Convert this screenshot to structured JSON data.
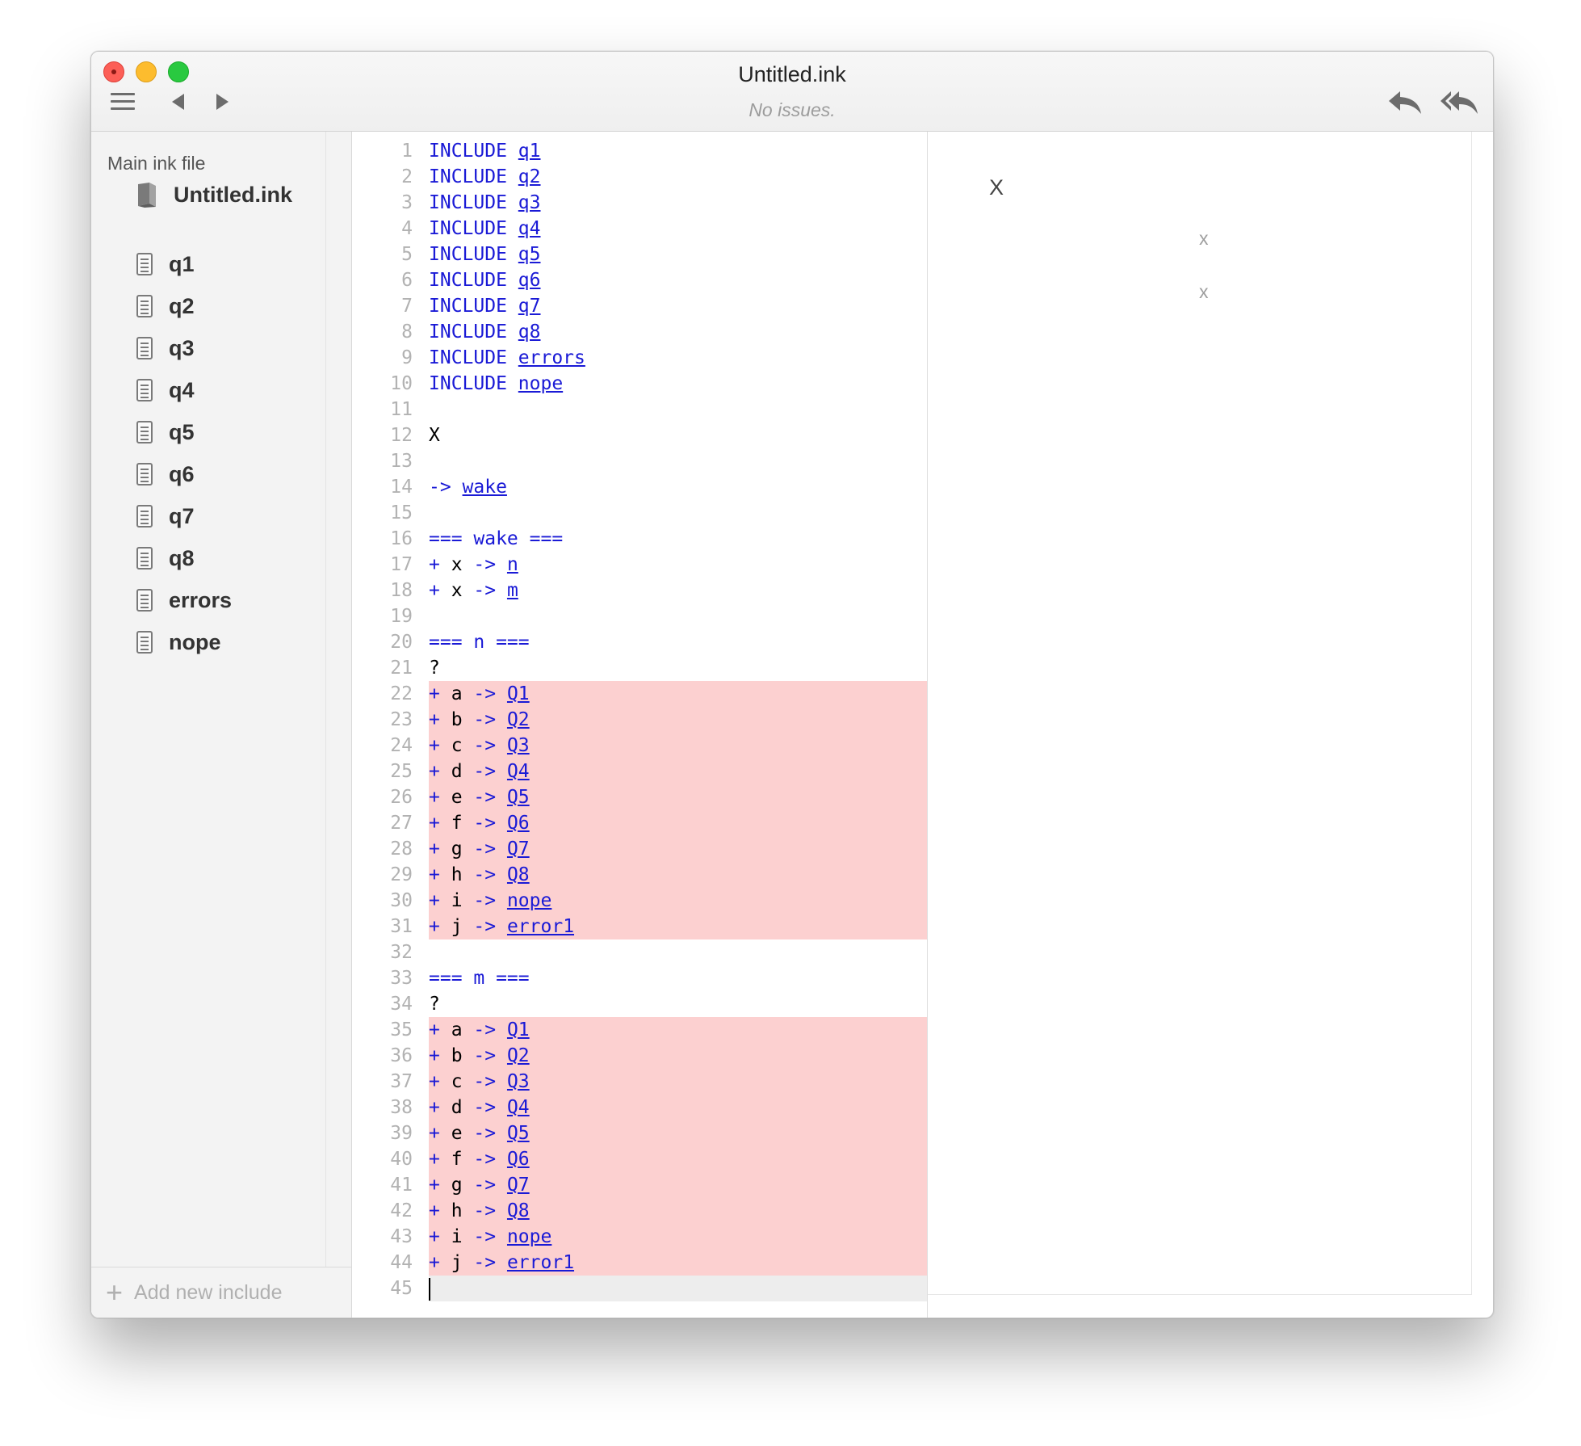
{
  "window": {
    "title": "Untitled.ink",
    "status": "No issues."
  },
  "toolbar": {
    "menu_icon": "hamburger-icon",
    "back_icon": "back-arrow-icon",
    "forward_icon": "forward-arrow-icon",
    "rewind_icon": "reply-icon",
    "restart_icon": "reply-all-icon"
  },
  "sidebar": {
    "heading": "Main ink file",
    "main_file": "Untitled.ink",
    "includes": [
      "q1",
      "q2",
      "q3",
      "q4",
      "q5",
      "q6",
      "q7",
      "q8",
      "errors",
      "nope"
    ],
    "add_label": "Add new include"
  },
  "editor": {
    "lines": [
      {
        "n": "1",
        "tokens": [
          [
            "kw",
            "INCLUDE "
          ],
          [
            "lnk",
            "q1"
          ]
        ]
      },
      {
        "n": "2",
        "tokens": [
          [
            "kw",
            "INCLUDE "
          ],
          [
            "lnk",
            "q2"
          ]
        ]
      },
      {
        "n": "3",
        "tokens": [
          [
            "kw",
            "INCLUDE "
          ],
          [
            "lnk",
            "q3"
          ]
        ]
      },
      {
        "n": "4",
        "tokens": [
          [
            "kw",
            "INCLUDE "
          ],
          [
            "lnk",
            "q4"
          ]
        ]
      },
      {
        "n": "5",
        "tokens": [
          [
            "kw",
            "INCLUDE "
          ],
          [
            "lnk",
            "q5"
          ]
        ]
      },
      {
        "n": "6",
        "tokens": [
          [
            "kw",
            "INCLUDE "
          ],
          [
            "lnk",
            "q6"
          ]
        ]
      },
      {
        "n": "7",
        "tokens": [
          [
            "kw",
            "INCLUDE "
          ],
          [
            "lnk",
            "q7"
          ]
        ]
      },
      {
        "n": "8",
        "tokens": [
          [
            "kw",
            "INCLUDE "
          ],
          [
            "lnk",
            "q8"
          ]
        ]
      },
      {
        "n": "9",
        "tokens": [
          [
            "kw",
            "INCLUDE "
          ],
          [
            "lnk",
            "errors"
          ]
        ]
      },
      {
        "n": "10",
        "tokens": [
          [
            "kw",
            "INCLUDE "
          ],
          [
            "lnk",
            "nope"
          ]
        ]
      },
      {
        "n": "11",
        "tokens": []
      },
      {
        "n": "12",
        "tokens": [
          [
            "txt",
            "X"
          ]
        ]
      },
      {
        "n": "13",
        "tokens": []
      },
      {
        "n": "14",
        "tokens": [
          [
            "kw",
            "-> "
          ],
          [
            "lnk",
            "wake"
          ]
        ]
      },
      {
        "n": "15",
        "tokens": []
      },
      {
        "n": "16",
        "tokens": [
          [
            "kw",
            "=== wake ==="
          ]
        ]
      },
      {
        "n": "17",
        "tokens": [
          [
            "kw",
            "+ "
          ],
          [
            "txt",
            "x "
          ],
          [
            "kw",
            "-> "
          ],
          [
            "lnk",
            "n"
          ]
        ]
      },
      {
        "n": "18",
        "tokens": [
          [
            "kw",
            "+ "
          ],
          [
            "txt",
            "x "
          ],
          [
            "kw",
            "-> "
          ],
          [
            "lnk",
            "m"
          ]
        ]
      },
      {
        "n": "19",
        "tokens": []
      },
      {
        "n": "20",
        "tokens": [
          [
            "kw",
            "=== n ==="
          ]
        ]
      },
      {
        "n": "21",
        "tokens": [
          [
            "txt",
            "?"
          ]
        ]
      },
      {
        "n": "22",
        "err": true,
        "tokens": [
          [
            "kw",
            "+ "
          ],
          [
            "txt",
            "a "
          ],
          [
            "kw",
            "-> "
          ],
          [
            "lnk",
            "Q1"
          ]
        ]
      },
      {
        "n": "23",
        "err": true,
        "tokens": [
          [
            "kw",
            "+ "
          ],
          [
            "txt",
            "b "
          ],
          [
            "kw",
            "-> "
          ],
          [
            "lnk",
            "Q2"
          ]
        ]
      },
      {
        "n": "24",
        "err": true,
        "tokens": [
          [
            "kw",
            "+ "
          ],
          [
            "txt",
            "c "
          ],
          [
            "kw",
            "-> "
          ],
          [
            "lnk",
            "Q3"
          ]
        ]
      },
      {
        "n": "25",
        "err": true,
        "tokens": [
          [
            "kw",
            "+ "
          ],
          [
            "txt",
            "d "
          ],
          [
            "kw",
            "-> "
          ],
          [
            "lnk",
            "Q4"
          ]
        ]
      },
      {
        "n": "26",
        "err": true,
        "tokens": [
          [
            "kw",
            "+ "
          ],
          [
            "txt",
            "e "
          ],
          [
            "kw",
            "-> "
          ],
          [
            "lnk",
            "Q5"
          ]
        ]
      },
      {
        "n": "27",
        "err": true,
        "tokens": [
          [
            "kw",
            "+ "
          ],
          [
            "txt",
            "f "
          ],
          [
            "kw",
            "-> "
          ],
          [
            "lnk",
            "Q6"
          ]
        ]
      },
      {
        "n": "28",
        "err": true,
        "tokens": [
          [
            "kw",
            "+ "
          ],
          [
            "txt",
            "g "
          ],
          [
            "kw",
            "-> "
          ],
          [
            "lnk",
            "Q7"
          ]
        ]
      },
      {
        "n": "29",
        "err": true,
        "tokens": [
          [
            "kw",
            "+ "
          ],
          [
            "txt",
            "h "
          ],
          [
            "kw",
            "-> "
          ],
          [
            "lnk",
            "Q8"
          ]
        ]
      },
      {
        "n": "30",
        "err": true,
        "tokens": [
          [
            "kw",
            "+ "
          ],
          [
            "txt",
            "i "
          ],
          [
            "kw",
            "-> "
          ],
          [
            "lnk",
            "nope"
          ]
        ]
      },
      {
        "n": "31",
        "err": true,
        "tokens": [
          [
            "kw",
            "+ "
          ],
          [
            "txt",
            "j "
          ],
          [
            "kw",
            "-> "
          ],
          [
            "lnk",
            "error1"
          ]
        ]
      },
      {
        "n": "32",
        "tokens": []
      },
      {
        "n": "33",
        "tokens": [
          [
            "kw",
            "=== m ==="
          ]
        ]
      },
      {
        "n": "34",
        "tokens": [
          [
            "txt",
            "?"
          ]
        ]
      },
      {
        "n": "35",
        "err": true,
        "tokens": [
          [
            "kw",
            "+ "
          ],
          [
            "txt",
            "a "
          ],
          [
            "kw",
            "-> "
          ],
          [
            "lnk",
            "Q1"
          ]
        ]
      },
      {
        "n": "36",
        "err": true,
        "tokens": [
          [
            "kw",
            "+ "
          ],
          [
            "txt",
            "b "
          ],
          [
            "kw",
            "-> "
          ],
          [
            "lnk",
            "Q2"
          ]
        ]
      },
      {
        "n": "37",
        "err": true,
        "tokens": [
          [
            "kw",
            "+ "
          ],
          [
            "txt",
            "c "
          ],
          [
            "kw",
            "-> "
          ],
          [
            "lnk",
            "Q3"
          ]
        ]
      },
      {
        "n": "38",
        "err": true,
        "tokens": [
          [
            "kw",
            "+ "
          ],
          [
            "txt",
            "d "
          ],
          [
            "kw",
            "-> "
          ],
          [
            "lnk",
            "Q4"
          ]
        ]
      },
      {
        "n": "39",
        "err": true,
        "tokens": [
          [
            "kw",
            "+ "
          ],
          [
            "txt",
            "e "
          ],
          [
            "kw",
            "-> "
          ],
          [
            "lnk",
            "Q5"
          ]
        ]
      },
      {
        "n": "40",
        "err": true,
        "tokens": [
          [
            "kw",
            "+ "
          ],
          [
            "txt",
            "f "
          ],
          [
            "kw",
            "-> "
          ],
          [
            "lnk",
            "Q6"
          ]
        ]
      },
      {
        "n": "41",
        "err": true,
        "tokens": [
          [
            "kw",
            "+ "
          ],
          [
            "txt",
            "g "
          ],
          [
            "kw",
            "-> "
          ],
          [
            "lnk",
            "Q7"
          ]
        ]
      },
      {
        "n": "42",
        "err": true,
        "tokens": [
          [
            "kw",
            "+ "
          ],
          [
            "txt",
            "h "
          ],
          [
            "kw",
            "-> "
          ],
          [
            "lnk",
            "Q8"
          ]
        ]
      },
      {
        "n": "43",
        "err": true,
        "tokens": [
          [
            "kw",
            "+ "
          ],
          [
            "txt",
            "i "
          ],
          [
            "kw",
            "-> "
          ],
          [
            "lnk",
            "nope"
          ]
        ]
      },
      {
        "n": "44",
        "err": true,
        "tokens": [
          [
            "kw",
            "+ "
          ],
          [
            "txt",
            "j "
          ],
          [
            "kw",
            "-> "
          ],
          [
            "lnk",
            "error1"
          ]
        ]
      },
      {
        "n": "45",
        "cur": true,
        "tokens": []
      }
    ]
  },
  "player": {
    "story_text": "X",
    "choices": [
      "x",
      "x"
    ]
  },
  "colors": {
    "keyword": "#1a1ad6",
    "error_highlight": "#fcd0d0",
    "current_line": "#ededed",
    "close_light": "#fc5f57",
    "minimize_light": "#fdbc2e",
    "maximize_light": "#29c940"
  }
}
